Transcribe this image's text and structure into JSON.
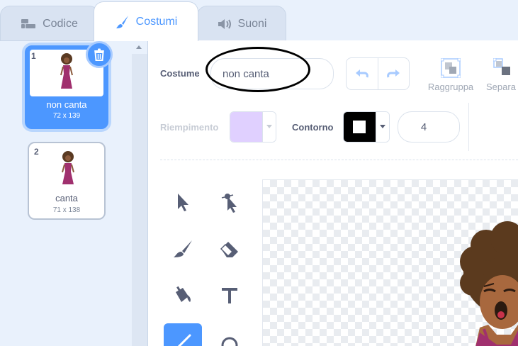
{
  "tabs": [
    {
      "label": "Codice",
      "icon": "code-blocks-icon",
      "active": false
    },
    {
      "label": "Costumi",
      "icon": "paintbrush-icon",
      "active": true
    },
    {
      "label": "Suoni",
      "icon": "speaker-icon",
      "active": false
    }
  ],
  "costumes": [
    {
      "number": "1",
      "name": "non canta",
      "dims": "72 x 139",
      "selected": true
    },
    {
      "number": "2",
      "name": "canta",
      "dims": "71 x 138",
      "selected": false
    }
  ],
  "editor": {
    "costume_label": "Costume",
    "costume_name": "non canta",
    "group_label": "Raggruppa",
    "ungroup_label": "Separa",
    "fill_label": "Riempimento",
    "outline_label": "Contorno",
    "outline_width": "4"
  },
  "colors": {
    "accent": "#4c97ff",
    "fill_swatch": "#e0d0ff",
    "outline_swatch": "#000000"
  }
}
